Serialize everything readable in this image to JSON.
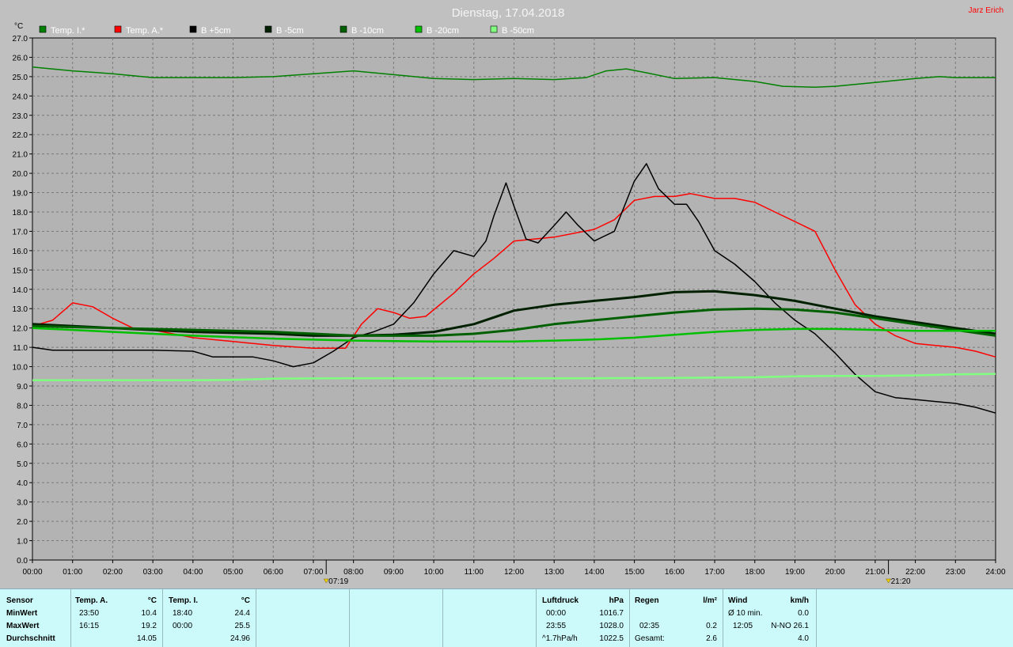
{
  "header": {
    "title": "Dienstag, 17.04.2018",
    "author": "Jarz Erich"
  },
  "chart_data": {
    "type": "line",
    "ylabel": "°C",
    "ylim": [
      0,
      27
    ],
    "xlim": [
      0,
      24
    ],
    "y_ticks": [
      "0.0",
      "1.0",
      "2.0",
      "3.0",
      "4.0",
      "5.0",
      "6.0",
      "7.0",
      "8.0",
      "9.0",
      "10.0",
      "11.0",
      "12.0",
      "13.0",
      "14.0",
      "15.0",
      "16.0",
      "17.0",
      "18.0",
      "19.0",
      "20.0",
      "21.0",
      "22.0",
      "23.0",
      "24.0",
      "25.0",
      "26.0",
      "27.0"
    ],
    "x_ticks": [
      "00:00",
      "01:00",
      "02:00",
      "03:00",
      "04:00",
      "05:00",
      "06:00",
      "07:00",
      "08:00",
      "09:00",
      "10:00",
      "11:00",
      "12:00",
      "13:00",
      "14:00",
      "15:00",
      "16:00",
      "17:00",
      "18:00",
      "19:00",
      "20:00",
      "21:00",
      "22:00",
      "23:00",
      "24:00"
    ],
    "grid": true,
    "legend_position": "top",
    "markers": [
      {
        "label": "07:19",
        "x": 7.32
      },
      {
        "label": "21:20",
        "x": 21.33
      }
    ],
    "series": [
      {
        "name": "Temp. I.*",
        "color": "#008000",
        "width": 1.5,
        "x": [
          0,
          1,
          2,
          3,
          4,
          5,
          6,
          7,
          8,
          9,
          10,
          11,
          12,
          13,
          13.8,
          14.3,
          14.8,
          15.3,
          16,
          17,
          18,
          18.7,
          19.5,
          20,
          21,
          22,
          22.6,
          23,
          24
        ],
        "y": [
          25.5,
          25.3,
          25.15,
          24.95,
          24.95,
          24.95,
          25.0,
          25.15,
          25.3,
          25.1,
          24.9,
          24.85,
          24.9,
          24.85,
          24.95,
          25.3,
          25.4,
          25.2,
          24.9,
          24.95,
          24.75,
          24.5,
          24.45,
          24.5,
          24.7,
          24.9,
          25.0,
          24.95,
          24.95
        ]
      },
      {
        "name": "Temp. A.*",
        "color": "#ff0000",
        "width": 1.5,
        "x": [
          0,
          0.5,
          1,
          1.5,
          2,
          2.5,
          3,
          4,
          5,
          6,
          7,
          7.8,
          8.2,
          8.6,
          9,
          9.4,
          9.8,
          10.5,
          11,
          11.5,
          12,
          12.5,
          13,
          14,
          14.5,
          15,
          15.5,
          16,
          16.4,
          17,
          17.5,
          18,
          18.5,
          19,
          19.5,
          20,
          20.5,
          21,
          21.5,
          22,
          22.5,
          23,
          23.5,
          24
        ],
        "y": [
          12.1,
          12.4,
          13.3,
          13.1,
          12.5,
          12.0,
          11.9,
          11.5,
          11.3,
          11.1,
          10.95,
          10.95,
          12.2,
          13.0,
          12.8,
          12.5,
          12.6,
          13.8,
          14.8,
          15.6,
          16.5,
          16.6,
          16.7,
          17.1,
          17.6,
          18.6,
          18.8,
          18.8,
          18.95,
          18.7,
          18.7,
          18.5,
          18.0,
          17.5,
          17.0,
          15.0,
          13.2,
          12.2,
          11.6,
          11.2,
          11.1,
          11.0,
          10.8,
          10.5
        ]
      },
      {
        "name": "B +5cm",
        "color": "#000000",
        "width": 1.5,
        "x": [
          0,
          0.5,
          1,
          2,
          3,
          4,
          4.5,
          5,
          5.5,
          6,
          6.5,
          7,
          7.5,
          8,
          8.5,
          9,
          9.5,
          10,
          10.5,
          11,
          11.3,
          11.5,
          11.8,
          12,
          12.3,
          12.6,
          13,
          13.3,
          13.6,
          14,
          14.5,
          15,
          15.3,
          15.6,
          16,
          16.3,
          16.6,
          17,
          17.5,
          18,
          18.5,
          19,
          19.5,
          20,
          20.5,
          21,
          21.5,
          22,
          22.5,
          23,
          23.5,
          24
        ],
        "y": [
          11.0,
          10.85,
          10.85,
          10.85,
          10.85,
          10.8,
          10.5,
          10.5,
          10.5,
          10.3,
          10.0,
          10.2,
          10.8,
          11.5,
          11.8,
          12.2,
          13.3,
          14.8,
          16.0,
          15.7,
          16.5,
          17.8,
          19.5,
          18.3,
          16.6,
          16.4,
          17.3,
          18.0,
          17.3,
          16.5,
          17.0,
          19.6,
          20.5,
          19.2,
          18.4,
          18.4,
          17.5,
          16.0,
          15.3,
          14.4,
          13.3,
          12.4,
          11.7,
          10.7,
          9.6,
          8.7,
          8.4,
          8.3,
          8.2,
          8.1,
          7.9,
          7.6
        ]
      },
      {
        "name": "B -5cm",
        "color": "#002000",
        "width": 3,
        "x": [
          0,
          2,
          4,
          6,
          7,
          8,
          9,
          10,
          11,
          12,
          13,
          14,
          15,
          16,
          17,
          18,
          19,
          20,
          21,
          22,
          23,
          24
        ],
        "y": [
          12.2,
          12.0,
          11.8,
          11.7,
          11.6,
          11.6,
          11.65,
          11.8,
          12.2,
          12.9,
          13.2,
          13.4,
          13.6,
          13.85,
          13.9,
          13.7,
          13.4,
          13.0,
          12.6,
          12.3,
          12.0,
          11.7
        ]
      },
      {
        "name": "B -10cm",
        "color": "#006000",
        "width": 3,
        "x": [
          0,
          2,
          4,
          6,
          8,
          10,
          11,
          12,
          13,
          14,
          15,
          16,
          17,
          18,
          19,
          20,
          21,
          22,
          23,
          24
        ],
        "y": [
          12.1,
          12.0,
          11.9,
          11.8,
          11.6,
          11.6,
          11.7,
          11.9,
          12.2,
          12.4,
          12.6,
          12.8,
          12.95,
          13.0,
          12.95,
          12.8,
          12.5,
          12.2,
          11.9,
          11.6
        ]
      },
      {
        "name": "B -20cm",
        "color": "#00c000",
        "width": 2.5,
        "x": [
          0,
          2,
          4,
          6,
          8,
          10,
          11,
          12,
          13,
          14,
          15,
          16,
          17,
          18,
          19,
          20,
          21,
          22,
          23,
          24
        ],
        "y": [
          12.0,
          11.8,
          11.6,
          11.45,
          11.35,
          11.3,
          11.3,
          11.3,
          11.35,
          11.4,
          11.5,
          11.65,
          11.8,
          11.9,
          11.95,
          11.95,
          11.9,
          11.85,
          11.85,
          11.85
        ]
      },
      {
        "name": "B -50cm",
        "color": "#80ff80",
        "width": 2.5,
        "x": [
          0,
          2,
          4,
          5,
          6,
          8,
          10,
          12,
          14,
          16,
          18,
          19,
          20,
          21,
          22,
          23,
          24
        ],
        "y": [
          9.3,
          9.3,
          9.3,
          9.32,
          9.38,
          9.4,
          9.4,
          9.4,
          9.4,
          9.42,
          9.45,
          9.5,
          9.52,
          9.52,
          9.55,
          9.6,
          9.62
        ]
      }
    ]
  },
  "stats": {
    "sensor": {
      "header": "Sensor",
      "rows": [
        "MinWert",
        "MaxWert",
        "Durchschnitt"
      ]
    },
    "temp_a": {
      "header": "Temp. A.",
      "unit": "°C",
      "min_time": "23:50",
      "min_val": "10.4",
      "max_time": "16:15",
      "max_val": "19.2",
      "avg": "14.05"
    },
    "temp_i": {
      "header": "Temp. I.",
      "unit": "°C",
      "min_time": "18:40",
      "min_val": "24.4",
      "max_time": "00:00",
      "max_val": "25.5",
      "avg": "24.96"
    },
    "luftdruck": {
      "header": "Luftdruck",
      "unit": "hPa",
      "min_time": "00:00",
      "min_val": "1016.7",
      "max_time": "23:55",
      "max_val": "1028.0",
      "trend_label": "^1.7hPa/h",
      "trend_val": "1022.5"
    },
    "regen": {
      "header": "Regen",
      "unit": "l/m²",
      "max_time": "02:35",
      "max_val": "0.2",
      "total_label": "Gesamt:",
      "total_val": "2.6"
    },
    "wind": {
      "header": "Wind",
      "unit": "km/h",
      "avg_label": "Ø 10 min.",
      "avg_val": "0.0",
      "max_time": "12:05",
      "max_val": "N-NO 26.1",
      "bottom_val": "4.0"
    }
  }
}
